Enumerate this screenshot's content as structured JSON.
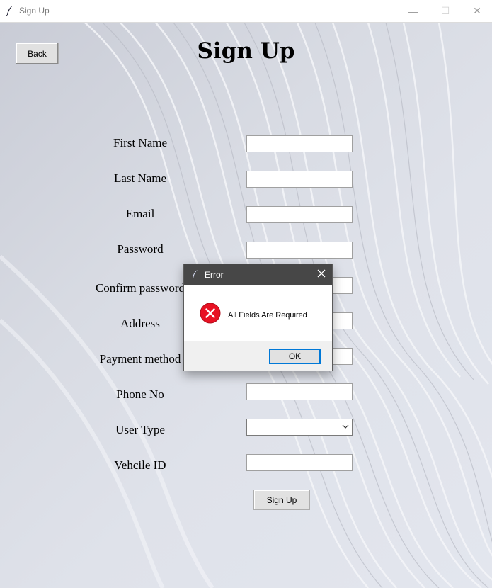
{
  "window": {
    "title": "Sign Up",
    "minimize_glyph": "—",
    "maximize_glyph": "☐",
    "close_glyph": "✕"
  },
  "page": {
    "heading": "Sign Up",
    "back_label": "Back",
    "submit_label": "Sign Up"
  },
  "form": {
    "fields": [
      {
        "label": "First Name",
        "value": ""
      },
      {
        "label": "Last Name",
        "value": ""
      },
      {
        "label": "Email",
        "value": ""
      },
      {
        "label": "Password",
        "value": ""
      },
      {
        "label": "Confirm password",
        "value": ""
      },
      {
        "label": "Address",
        "value": ""
      },
      {
        "label": "Payment method",
        "value": ""
      },
      {
        "label": "Phone No",
        "value": ""
      },
      {
        "label": "User Type",
        "value": "",
        "type": "dropdown"
      },
      {
        "label": "Vehcile ID",
        "value": ""
      }
    ]
  },
  "dialog": {
    "title": "Error",
    "message": "All Fields Are Required",
    "ok_label": "OK",
    "icon": "error-icon",
    "icon_color": "#e81123"
  },
  "colors": {
    "accent": "#0078d7",
    "dialog_titlebar": "#474747"
  }
}
